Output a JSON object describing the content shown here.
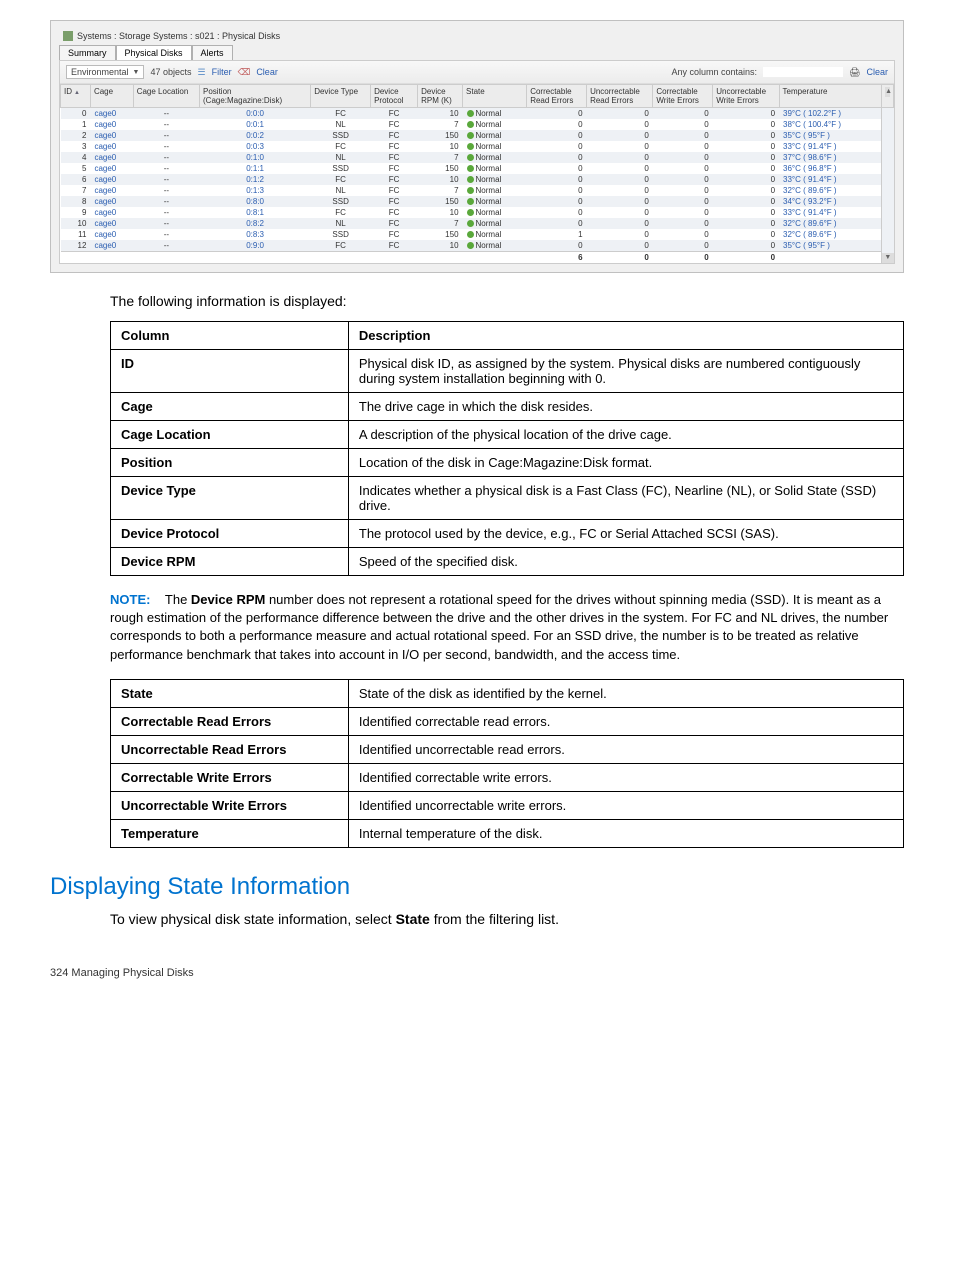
{
  "app": {
    "title": "Systems : Storage Systems : s021 : Physical Disks",
    "tabs": [
      "Summary",
      "Physical Disks",
      "Alerts"
    ],
    "activeTab": 1
  },
  "toolbar": {
    "filterDropdown": "Environmental",
    "count": "47 objects",
    "filterLink": "Filter",
    "clearLink": "Clear",
    "searchLabel": "Any column contains:",
    "searchValue": "",
    "rightClear": "Clear"
  },
  "grid": {
    "headers": [
      "ID",
      "Cage",
      "Cage Location",
      "Position (Cage:Magazine:Disk)",
      "Device Type",
      "Device Protocol",
      "Device RPM (K)",
      "State",
      "Correctable Read Errors",
      "Uncorrectable Read Errors",
      "Correctable Write Errors",
      "Uncorrectable Write Errors",
      "Temperature"
    ],
    "rows": [
      {
        "id": "0",
        "cage": "cage0",
        "loc": "--",
        "pos": "0:0:0",
        "dtype": "FC",
        "proto": "FC",
        "rpm": "10",
        "state": "Normal",
        "cr": "0",
        "ur": "0",
        "cw": "0",
        "uw": "0",
        "temp": "39°C ( 102.2°F )"
      },
      {
        "id": "1",
        "cage": "cage0",
        "loc": "--",
        "pos": "0:0:1",
        "dtype": "NL",
        "proto": "FC",
        "rpm": "7",
        "state": "Normal",
        "cr": "0",
        "ur": "0",
        "cw": "0",
        "uw": "0",
        "temp": "38°C ( 100.4°F )"
      },
      {
        "id": "2",
        "cage": "cage0",
        "loc": "--",
        "pos": "0:0:2",
        "dtype": "SSD",
        "proto": "FC",
        "rpm": "150",
        "state": "Normal",
        "cr": "0",
        "ur": "0",
        "cw": "0",
        "uw": "0",
        "temp": "35°C ( 95°F )"
      },
      {
        "id": "3",
        "cage": "cage0",
        "loc": "--",
        "pos": "0:0:3",
        "dtype": "FC",
        "proto": "FC",
        "rpm": "10",
        "state": "Normal",
        "cr": "0",
        "ur": "0",
        "cw": "0",
        "uw": "0",
        "temp": "33°C ( 91.4°F )"
      },
      {
        "id": "4",
        "cage": "cage0",
        "loc": "--",
        "pos": "0:1:0",
        "dtype": "NL",
        "proto": "FC",
        "rpm": "7",
        "state": "Normal",
        "cr": "0",
        "ur": "0",
        "cw": "0",
        "uw": "0",
        "temp": "37°C ( 98.6°F )"
      },
      {
        "id": "5",
        "cage": "cage0",
        "loc": "--",
        "pos": "0:1:1",
        "dtype": "SSD",
        "proto": "FC",
        "rpm": "150",
        "state": "Normal",
        "cr": "0",
        "ur": "0",
        "cw": "0",
        "uw": "0",
        "temp": "36°C ( 96.8°F )"
      },
      {
        "id": "6",
        "cage": "cage0",
        "loc": "--",
        "pos": "0:1:2",
        "dtype": "FC",
        "proto": "FC",
        "rpm": "10",
        "state": "Normal",
        "cr": "0",
        "ur": "0",
        "cw": "0",
        "uw": "0",
        "temp": "33°C ( 91.4°F )"
      },
      {
        "id": "7",
        "cage": "cage0",
        "loc": "--",
        "pos": "0:1:3",
        "dtype": "NL",
        "proto": "FC",
        "rpm": "7",
        "state": "Normal",
        "cr": "0",
        "ur": "0",
        "cw": "0",
        "uw": "0",
        "temp": "32°C ( 89.6°F )"
      },
      {
        "id": "8",
        "cage": "cage0",
        "loc": "--",
        "pos": "0:8:0",
        "dtype": "SSD",
        "proto": "FC",
        "rpm": "150",
        "state": "Normal",
        "cr": "0",
        "ur": "0",
        "cw": "0",
        "uw": "0",
        "temp": "34°C ( 93.2°F )"
      },
      {
        "id": "9",
        "cage": "cage0",
        "loc": "--",
        "pos": "0:8:1",
        "dtype": "FC",
        "proto": "FC",
        "rpm": "10",
        "state": "Normal",
        "cr": "0",
        "ur": "0",
        "cw": "0",
        "uw": "0",
        "temp": "33°C ( 91.4°F )"
      },
      {
        "id": "10",
        "cage": "cage0",
        "loc": "--",
        "pos": "0:8:2",
        "dtype": "NL",
        "proto": "FC",
        "rpm": "7",
        "state": "Normal",
        "cr": "0",
        "ur": "0",
        "cw": "0",
        "uw": "0",
        "temp": "32°C ( 89.6°F )"
      },
      {
        "id": "11",
        "cage": "cage0",
        "loc": "--",
        "pos": "0:8:3",
        "dtype": "SSD",
        "proto": "FC",
        "rpm": "150",
        "state": "Normal",
        "cr": "1",
        "ur": "0",
        "cw": "0",
        "uw": "0",
        "temp": "32°C ( 89.6°F )"
      },
      {
        "id": "12",
        "cage": "cage0",
        "loc": "--",
        "pos": "0:9:0",
        "dtype": "FC",
        "proto": "FC",
        "rpm": "10",
        "state": "Normal",
        "cr": "0",
        "ur": "0",
        "cw": "0",
        "uw": "0",
        "temp": "35°C ( 95°F )"
      }
    ],
    "footer": {
      "cr": "6",
      "ur": "0",
      "cw": "0",
      "uw": "0"
    }
  },
  "intro": "The following information is displayed:",
  "table1": {
    "header": [
      "Column",
      "Description"
    ],
    "rows": [
      [
        "ID",
        "Physical disk ID, as assigned by the system. Physical disks are numbered contiguously during system installation beginning with 0."
      ],
      [
        "Cage",
        "The drive cage in which the disk resides."
      ],
      [
        "Cage Location",
        "A description of the physical location of the drive cage."
      ],
      [
        "Position",
        "Location of the disk in Cage:Magazine:Disk format."
      ],
      [
        "Device Type",
        "Indicates whether a physical disk is a Fast Class (FC), Nearline (NL), or Solid State (SSD) drive."
      ],
      [
        "Device Protocol",
        "The protocol used by the device, e.g., FC or Serial Attached SCSI (SAS)."
      ],
      [
        "Device RPM",
        "Speed of the specified disk."
      ]
    ]
  },
  "note": {
    "label": "NOTE:",
    "prefix": "The ",
    "bold": "Device RPM",
    "text": " number does not represent a rotational speed for the drives without spinning media (SSD). It is meant as a rough estimation of the performance difference between the drive and the other drives in the system. For FC and NL drives, the number corresponds to both a performance measure and actual rotational speed. For an SSD drive, the number is to be treated as relative performance benchmark that takes into account in I/O per second, bandwidth, and the access time."
  },
  "table2": {
    "rows": [
      [
        "State",
        "State of the disk as identified by the kernel."
      ],
      [
        "Correctable Read Errors",
        "Identified correctable read errors."
      ],
      [
        "Uncorrectable Read Errors",
        "Identified uncorrectable read errors."
      ],
      [
        "Correctable Write Errors",
        "Identified correctable write errors."
      ],
      [
        "Uncorrectable Write Errors",
        "Identified uncorrectable write errors."
      ],
      [
        "Temperature",
        "Internal temperature of the disk."
      ]
    ]
  },
  "heading": "Displaying State Information",
  "subtext": {
    "p1": "To view physical disk state information, select ",
    "b": "State",
    "p2": " from the filtering list."
  },
  "footer": "324   Managing Physical Disks"
}
